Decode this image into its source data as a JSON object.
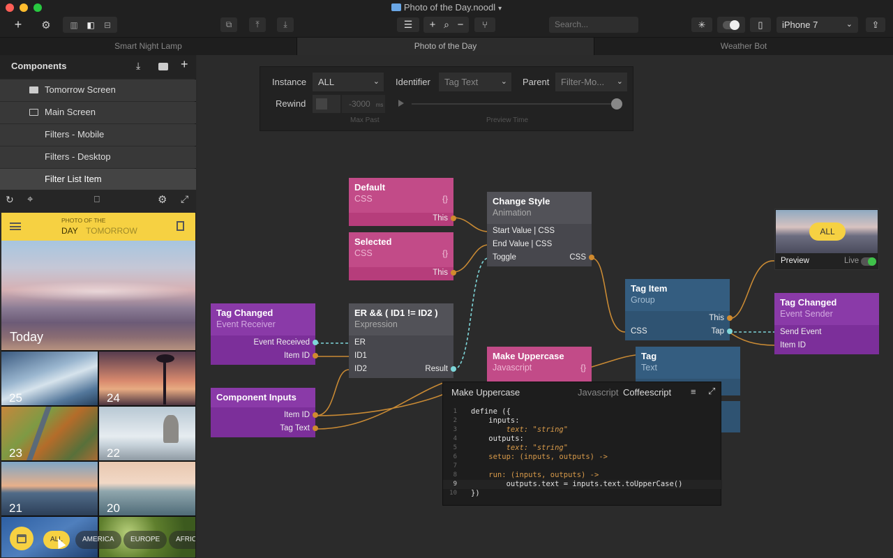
{
  "window": {
    "title": "Photo of the Day.noodl"
  },
  "toolbar": {
    "search_placeholder": "Search...",
    "device": "iPhone 7"
  },
  "tabs": [
    {
      "label": "Smart Night Lamp"
    },
    {
      "label": "Photo of the Day"
    },
    {
      "label": "Weather Bot"
    }
  ],
  "sidebar": {
    "title": "Components",
    "items": [
      {
        "label": "Tomorrow Screen"
      },
      {
        "label": "Main Screen"
      },
      {
        "label": "Filters - Mobile"
      },
      {
        "label": "Filters - Desktop"
      },
      {
        "label": "Filter List Item"
      }
    ]
  },
  "preview": {
    "header_line1": "PHOTO OF THE",
    "day": "DAY",
    "tomorrow": "TOMORROW",
    "today": "Today",
    "thumbs": [
      "25",
      "24",
      "23",
      "22",
      "21",
      "20"
    ],
    "pills": [
      "ALL",
      "AMERICA",
      "EUROPE",
      "AFRICA"
    ]
  },
  "inspector": {
    "instance_label": "Instance",
    "instance_value": "ALL",
    "identifier_label": "Identifier",
    "identifier_value": "Tag Text",
    "parent_label": "Parent",
    "parent_value": "Filter-Mo...",
    "rewind_label": "Rewind",
    "rewind_value": "-3000",
    "rewind_unit": "ms",
    "max_past": "Max Past",
    "preview_time": "Preview Time"
  },
  "nodes": {
    "default_css": {
      "title": "Default",
      "type": "CSS",
      "port_this": "This"
    },
    "selected_css": {
      "title": "Selected",
      "type": "CSS",
      "port_this": "This"
    },
    "change_style": {
      "title": "Change Style",
      "type": "Animation",
      "start": "Start Value | CSS",
      "end": "End Value | CSS",
      "toggle": "Toggle",
      "css": "CSS"
    },
    "tag_changed_rx": {
      "title": "Tag Changed",
      "type": "Event Receiver",
      "event_received": "Event Received",
      "item_id": "Item ID"
    },
    "expression": {
      "title": "ER && ( ID1 != ID2 )",
      "type": "Expression",
      "er": "ER",
      "id1": "ID1",
      "id2": "ID2",
      "result": "Result"
    },
    "component_inputs": {
      "title": "Component Inputs",
      "item_id": "Item ID",
      "tag_text": "Tag Text"
    },
    "tag_item": {
      "title": "Tag Item",
      "type": "Group",
      "this": "This",
      "css": "CSS",
      "tap": "Tap"
    },
    "make_uppercase": {
      "title": "Make Uppercase",
      "type": "Javascript"
    },
    "tag_text": {
      "title": "Tag",
      "type": "Text"
    },
    "preview_node": {
      "pill": "ALL",
      "preview": "Preview",
      "live": "Live"
    },
    "tag_changed_tx": {
      "title": "Tag Changed",
      "type": "Event Sender",
      "send_event": "Send Event",
      "item_id": "Item ID"
    }
  },
  "editor": {
    "title": "Make Uppercase",
    "lang_js": "Javascript",
    "lang_cs": "Coffeescript",
    "lines": [
      [
        "1",
        "define ({"
      ],
      [
        "2",
        "    inputs:"
      ],
      [
        "3",
        "        text: \"string\""
      ],
      [
        "4",
        "    outputs:"
      ],
      [
        "5",
        "        text: \"string\""
      ],
      [
        "6",
        "    setup: (inputs, outputs) ->"
      ],
      [
        "7",
        ""
      ],
      [
        "8",
        "    run: (inputs, outputs) ->"
      ],
      [
        "9",
        "        outputs.text = inputs.text.toUpperCase()"
      ],
      [
        "10",
        "})"
      ]
    ]
  },
  "colors": {
    "pink": "#b63d7b",
    "purple": "#7c2f9a",
    "gray_node": "#47474d",
    "blue_node": "#2f5372",
    "wire_orange": "#c98a34",
    "wire_cyan": "#7ed6d9",
    "accent_yellow": "#f6d142",
    "live_green": "#3fc24a"
  }
}
